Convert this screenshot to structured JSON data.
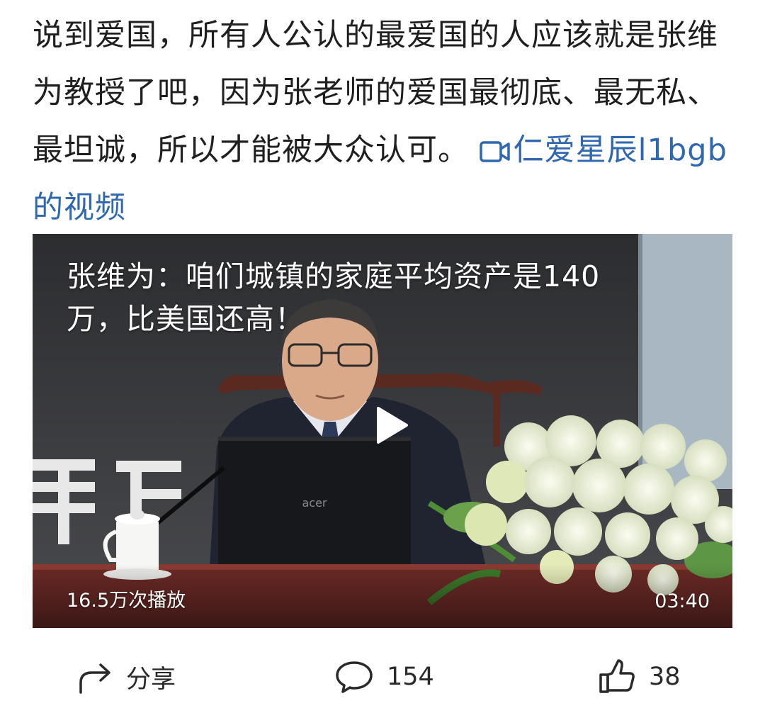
{
  "post": {
    "text": "说到爱国，所有人公认的最爱国的人应该就是张维为教授了吧，因为张老师的爱国最彻底、最无私、最坦诚，所以才能被大众认可。",
    "video_link": "仁爱星辰l1bgb的视频",
    "video_link_icon": "video-camera-icon"
  },
  "video": {
    "title": "张维为：咱们城镇的家庭平均资产是140万，比美国还高！",
    "plays": "16.5万次播放",
    "duration": "03:40",
    "laptop_brand": "acer",
    "backdrop_text": "里石"
  },
  "actions": {
    "share_label": "分享",
    "comment_count": "154",
    "like_count": "38"
  },
  "colors": {
    "link": "#2f68b1",
    "text": "#1f1f1f"
  }
}
